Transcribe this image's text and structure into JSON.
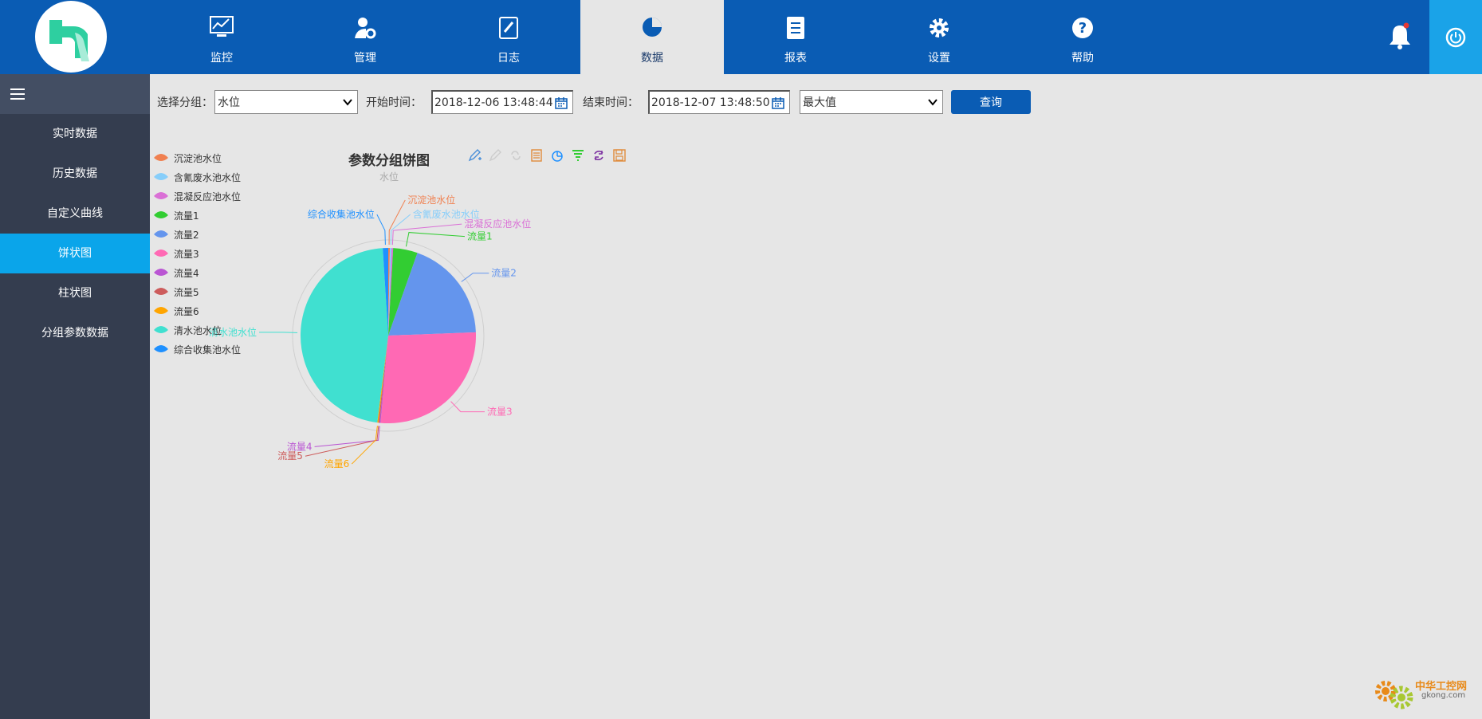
{
  "nav": {
    "items": [
      {
        "label": "监控",
        "icon": "monitor-chart-icon"
      },
      {
        "label": "管理",
        "icon": "user-gear-icon"
      },
      {
        "label": "日志",
        "icon": "notebook-icon"
      },
      {
        "label": "数据",
        "icon": "pie-icon"
      },
      {
        "label": "报表",
        "icon": "report-icon"
      },
      {
        "label": "设置",
        "icon": "gear-icon"
      },
      {
        "label": "帮助",
        "icon": "help-icon"
      }
    ],
    "active": "数据"
  },
  "sidebar": {
    "items": [
      {
        "label": "实时数据"
      },
      {
        "label": "历史数据"
      },
      {
        "label": "自定义曲线"
      },
      {
        "label": "饼状图"
      },
      {
        "label": "柱状图"
      },
      {
        "label": "分组参数数据"
      }
    ],
    "active": "饼状图"
  },
  "filters": {
    "group_label": "选择分组：",
    "group_value": "水位",
    "start_label": "开始时间：",
    "start_value": "2018-12-06 13:48:44",
    "end_label": "结束时间：",
    "end_value": "2018-12-07 13:48:50",
    "stat_value": "最大值",
    "query_label": "查询"
  },
  "chart_data": {
    "type": "pie",
    "title": "参数分组饼图",
    "subtitle": "水位",
    "legend_position": "left",
    "series": [
      {
        "name": "沉淀池水位",
        "value": 0.3,
        "color": "#f08050"
      },
      {
        "name": "含氰废水池水位",
        "value": 0.3,
        "color": "#87cefa"
      },
      {
        "name": "混凝反应池水位",
        "value": 0.3,
        "color": "#da70d6"
      },
      {
        "name": "流量1",
        "value": 4.5,
        "color": "#32cd32"
      },
      {
        "name": "流量2",
        "value": 19,
        "color": "#6495ed"
      },
      {
        "name": "流量3",
        "value": 27,
        "color": "#ff69b4"
      },
      {
        "name": "流量4",
        "value": 0.2,
        "color": "#ba55d3"
      },
      {
        "name": "流量5",
        "value": 0.2,
        "color": "#cd5c5c"
      },
      {
        "name": "流量6",
        "value": 0.2,
        "color": "#ffa500"
      },
      {
        "name": "清水池水位",
        "value": 47,
        "color": "#40e0d0"
      },
      {
        "name": "综合收集池水位",
        "value": 1.0,
        "color": "#1e90ff"
      }
    ]
  },
  "watermark": {
    "text": "中华工控网",
    "sub": "gkong.com"
  }
}
